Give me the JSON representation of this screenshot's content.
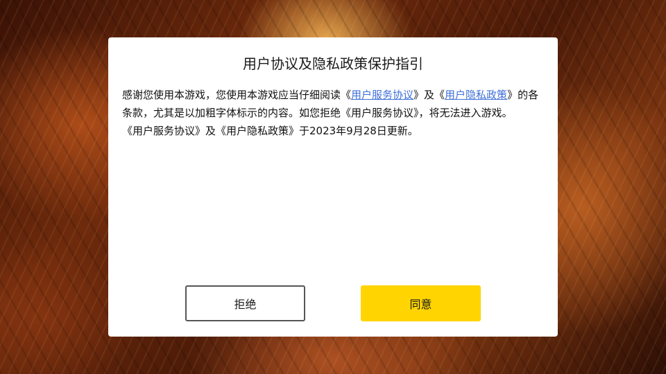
{
  "dialog": {
    "title": "用户协议及隐私政策保护指引",
    "body": {
      "p1_prefix": "感谢您使用本游戏，您使用本游戏应当仔细阅读《",
      "link_service": "用户服务协议",
      "p1_mid": "》及《",
      "link_privacy": "用户隐私政策",
      "p1_suffix": "》的各条款，尤其是以加粗字体标示的内容。如您拒绝《用户服务协议》，将无法进入游戏。",
      "p2": "《用户服务协议》及《用户隐私政策》于2023年9月28日更新。"
    },
    "buttons": {
      "reject_label": "拒绝",
      "agree_label": "同意"
    }
  },
  "colors": {
    "agree_button": "#ffd400",
    "link": "#3f6fd8",
    "dialog_background": "#ffffff"
  }
}
